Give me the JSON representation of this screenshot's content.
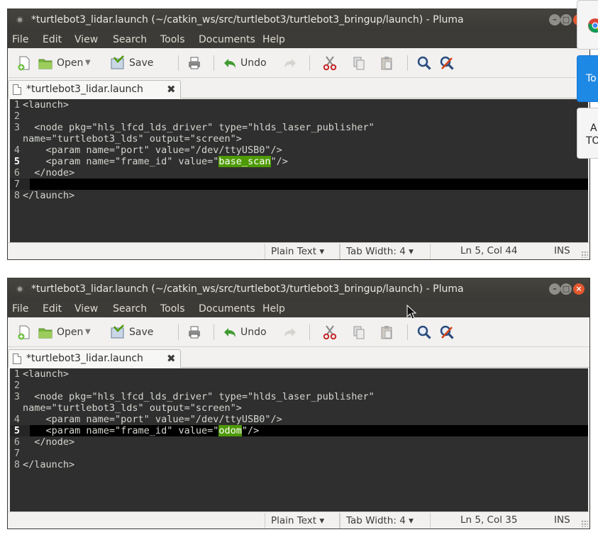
{
  "windows": [
    {
      "title": "*turtlebot3_lidar.launch (~/catkin_ws/src/turtlebot3/turtlebot3_bringup/launch) - Pluma",
      "menu": [
        "File",
        "Edit",
        "View",
        "Search",
        "Tools",
        "Documents",
        "Help"
      ],
      "toolbar": {
        "open_label": "Open",
        "save_label": "Save",
        "undo_label": "Undo"
      },
      "tab": {
        "label": "*turtlebot3_lidar.launch",
        "close": "✖"
      },
      "lines": [
        {
          "n": "1",
          "pre": "<launch>",
          "hl": "",
          "post": ""
        },
        {
          "n": "2",
          "pre": "",
          "hl": "",
          "post": ""
        },
        {
          "n": "3",
          "pre": "  <node pkg=\"hls_lfcd_lds_driver\" type=\"hlds_laser_publisher\"",
          "hl": "",
          "post": ""
        },
        {
          "n": "",
          "pre": "name=\"turtlebot3_lds\" output=\"screen\">",
          "hl": "",
          "post": ""
        },
        {
          "n": "4",
          "pre": "    <param name=\"port\" value=\"/dev/ttyUSB0\"/>",
          "hl": "",
          "post": ""
        },
        {
          "n": "5",
          "pre": "    <param name=\"frame_id\" value=\"",
          "hl": "base_scan",
          "post": "\"/>"
        },
        {
          "n": "6",
          "pre": "  </node>",
          "hl": "",
          "post": ""
        },
        {
          "n": "7",
          "pre": "",
          "hl": "",
          "post": ""
        },
        {
          "n": "8",
          "pre": "</launch>",
          "hl": "",
          "post": ""
        }
      ],
      "status": {
        "language": "Plain Text ▾",
        "tab_width": "Tab Width:  4 ▾",
        "position": "Ln 5, Col 44",
        "mode": "INS"
      }
    },
    {
      "title": "*turtlebot3_lidar.launch (~/catkin_ws/src/turtlebot3/turtlebot3_bringup/launch) - Pluma",
      "menu": [
        "File",
        "Edit",
        "View",
        "Search",
        "Tools",
        "Documents",
        "Help"
      ],
      "toolbar": {
        "open_label": "Open",
        "save_label": "Save",
        "undo_label": "Undo"
      },
      "tab": {
        "label": "*turtlebot3_lidar.launch",
        "close": "✖"
      },
      "lines": [
        {
          "n": "1",
          "pre": "<launch>",
          "hl": "",
          "post": ""
        },
        {
          "n": "2",
          "pre": "",
          "hl": "",
          "post": ""
        },
        {
          "n": "3",
          "pre": "  <node pkg=\"hls_lfcd_lds_driver\" type=\"hlds_laser_publisher\"",
          "hl": "",
          "post": ""
        },
        {
          "n": "",
          "pre": "name=\"turtlebot3_lds\" output=\"screen\">",
          "hl": "",
          "post": ""
        },
        {
          "n": "4",
          "pre": "    <param name=\"port\" value=\"/dev/ttyUSB0\"/>",
          "hl": "",
          "post": ""
        },
        {
          "n": "5",
          "pre": "    <param name=\"frame_id\" value=\"",
          "hl": "odom",
          "post": "\"/>"
        },
        {
          "n": "6",
          "pre": "  </node>",
          "hl": "",
          "post": ""
        },
        {
          "n": "7",
          "pre": "",
          "hl": "",
          "post": ""
        },
        {
          "n": "8",
          "pre": "</launch>",
          "hl": "",
          "post": ""
        }
      ],
      "status": {
        "language": "Plain Text ▾",
        "tab_width": "Tab Width:  4 ▾",
        "position": "Ln 5, Col 35",
        "mode": "INS"
      }
    }
  ],
  "side_panel": {
    "item2": "To",
    "item3_line1": "A",
    "item3_line2": "TO"
  },
  "colors": {
    "selection": "#4e9a06",
    "editor_bg": "#2f2f2f",
    "titlebar": "#3c3b37",
    "close_button": "#e4572e"
  }
}
